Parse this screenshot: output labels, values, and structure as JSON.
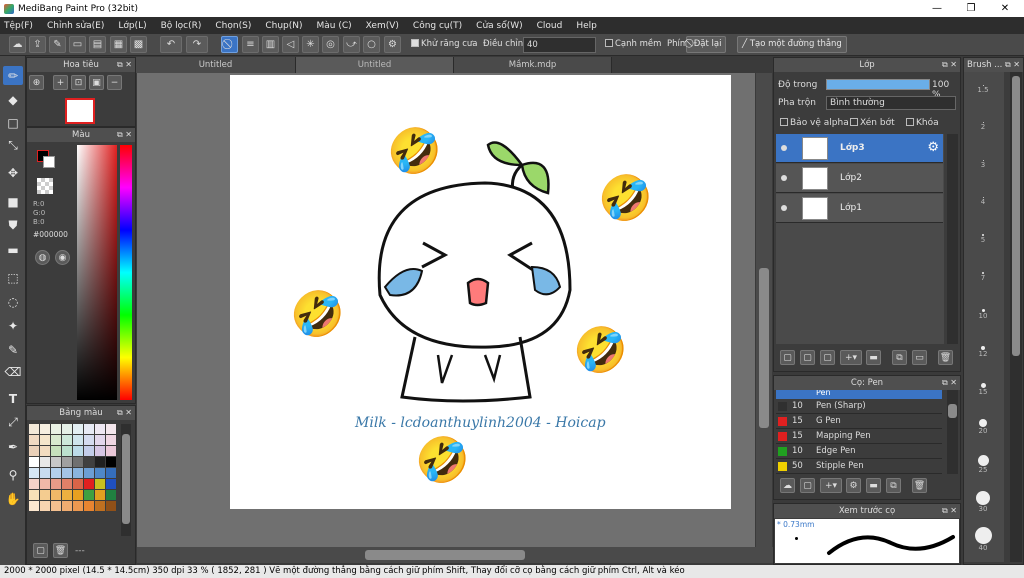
{
  "window": {
    "title": "MediBang Paint Pro (32bit)",
    "min": "—",
    "max": "❐",
    "close": "✕"
  },
  "menu": [
    "Tệp(F)",
    "Chỉnh sửa(E)",
    "Lớp(L)",
    "Bộ lọc(R)",
    "Chọn(S)",
    "Chụp(N)",
    "Màu (C)",
    "Xem(V)",
    "Công cụ(T)",
    "Cửa sổ(W)",
    "Cloud",
    "Help"
  ],
  "toolbar": {
    "antialias_label": "Khử răng cưa",
    "correction_label": "Điều chỉnh",
    "correction_value": "40",
    "smooth_label": "Cạnh mềm",
    "key_label": "Phím",
    "reset_label": "Đặt lại",
    "straight_label": "Tạo một đường thẳng"
  },
  "navigator": {
    "title": "Hoa tiêu"
  },
  "color": {
    "title": "Màu",
    "r": "R:0",
    "g": "G:0",
    "b": "B:0",
    "hex": "#000000"
  },
  "palette": {
    "title": "Bảng màu",
    "footer": "---",
    "swatches": [
      "#f2e8d8",
      "#f6efe0",
      "#e9f1e4",
      "#e4efe6",
      "#e2eef2",
      "#e6e9f4",
      "#ede7f2",
      "#f3e6ec",
      "#f0d9c2",
      "#f5e6cb",
      "#d8e9cf",
      "#cde8da",
      "#cfe4ec",
      "#d4dbef",
      "#e2d7ec",
      "#efd6e2",
      "#ead0b8",
      "#f2dcc0",
      "#c6e0bc",
      "#bbe0cd",
      "#bcdbe8",
      "#c3cde9",
      "#d6c6e4",
      "#ebc8d8",
      "#ffffff",
      "#e8e8e8",
      "#c8c8c8",
      "#a0a0a0",
      "#707070",
      "#404040",
      "#202020",
      "#000000",
      "#d6e6f4",
      "#c8dcf0",
      "#b4d0ec",
      "#a4c4e6",
      "#8ab4de",
      "#6c9ed4",
      "#4f88c8",
      "#356ebc",
      "#f4d2c8",
      "#f0b8a8",
      "#e89c88",
      "#e08068",
      "#d86448",
      "#e02020",
      "#c8c020",
      "#2050c0",
      "#f8e0b8",
      "#f4cc90",
      "#f0b868",
      "#ecb040",
      "#e8a020",
      "#40a040",
      "#e0a020",
      "#208040",
      "#fce8d0",
      "#f8d4b0",
      "#f4c090",
      "#f0ac70",
      "#ec9850",
      "#e88430",
      "#c07020",
      "#905018"
    ]
  },
  "tabs": [
    "Untitled",
    "Untitled",
    "Mầmk.mdp"
  ],
  "canvas": {
    "signature": "Milk - lcdoanthuylinh2004 - Hoicap",
    "emoji": "🤣"
  },
  "layers": {
    "title": "Lớp",
    "opacity_label": "Độ trong",
    "opacity_value": "100 %",
    "blend_label": "Pha trộn",
    "blend_value": "Bình thường",
    "protect_alpha": "Bảo vệ alpha",
    "clip": "Xén bớt",
    "lock": "Khóa",
    "items": [
      {
        "name": "Lớp3",
        "selected": true
      },
      {
        "name": "Lớp2",
        "selected": false
      },
      {
        "name": "Lớp1",
        "selected": false
      }
    ]
  },
  "brush": {
    "title": "Cọ: Pen",
    "items": [
      {
        "size": "10",
        "name": "Pen (Sharp)",
        "color": "#303030"
      },
      {
        "size": "15",
        "name": "G Pen",
        "color": "#e02020"
      },
      {
        "size": "15",
        "name": "Mapping Pen",
        "color": "#e02020"
      },
      {
        "size": "10",
        "name": "Edge Pen",
        "color": "#20a020"
      },
      {
        "size": "50",
        "name": "Stipple Pen",
        "color": "#f0d000"
      }
    ],
    "partial_top": "Pen"
  },
  "preview": {
    "title": "Xem trước cọ",
    "size": "* 0.73mm"
  },
  "brushsize": {
    "title": "Brush ...",
    "sizes": [
      "1.5",
      "2",
      "3",
      "4",
      "5",
      "7",
      "10",
      "12",
      "15",
      "20",
      "25",
      "30",
      "40"
    ]
  },
  "status": "2000 * 2000 pixel   (14.5 * 14.5cm)   350 dpi   33 %   ( 1852, 281 )   Vẽ một đường thẳng bằng cách giữ phím Shift, Thay đổi cỡ cọ bằng cách giữ phím Ctrl, Alt và kéo"
}
